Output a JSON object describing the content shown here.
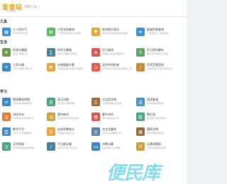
{
  "header": {
    "logo": "查查站",
    "logo_sub": "一 天天查询",
    "nav": "常用工具 ˅"
  },
  "sections": [
    {
      "title": "工具",
      "items": [
        {
          "title": "二十四节气",
          "desc": "24节气时间查询",
          "icon": "calendar-icon",
          "color": "#3a8fd6",
          "glyph": "▦"
        },
        {
          "title": "大家文创查询",
          "desc": "一键查询文创全方位查询",
          "icon": "document-icon",
          "color": "#5db865",
          "glyph": "▤"
        },
        {
          "title": "姓名缘分测试",
          "desc": "通过双方姓名测试配对指数",
          "icon": "heart-icon",
          "color": "#e8a33d",
          "glyph": "♥"
        },
        {
          "title": "星座性格查询",
          "desc": "一键查询十二星座性格",
          "icon": "star-icon",
          "color": "#3e8fd4",
          "glyph": "★"
        }
      ]
    },
    {
      "title": "生活",
      "items": [
        {
          "title": "在线计算器",
          "desc": "在线计算器工具",
          "icon": "calculator-icon",
          "color": "#6a9a4a",
          "glyph": "#"
        },
        {
          "title": "科学计算器",
          "desc": "科学计算器在线使用",
          "icon": "calculator-icon",
          "color": "#4a7f9c",
          "glyph": "∑"
        },
        {
          "title": "生日查询",
          "desc": "查询生日对应的星座日子",
          "icon": "cake-icon",
          "color": "#d9534f",
          "glyph": "✿"
        },
        {
          "title": "生日密码解析",
          "desc": "解析属于你的生日密码",
          "icon": "number-icon",
          "color": "#5aa06a",
          "glyph": "9"
        },
        {
          "title": "工资计算",
          "desc": "工资计算器个税计算",
          "icon": "money-icon",
          "color": "#3b86c7",
          "glyph": "¥"
        },
        {
          "title": "存储速度计算",
          "desc": "存储设备读写速度计算结果",
          "icon": "disk-icon",
          "color": "#e6a23c",
          "glyph": "⬒"
        },
        {
          "title": "北京时间检查",
          "desc": "北京时间北京时间标准在线工具",
          "icon": "clock-icon",
          "color": "#e05b4b",
          "glyph": "◷"
        },
        {
          "title": "声音音频音标",
          "desc": "在线查询汉字音标对照大全",
          "icon": "audio-icon",
          "color": "#c8883a",
          "glyph": "♪"
        }
      ]
    },
    {
      "title": "学习",
      "items": [
        {
          "title": "简体繁体转换",
          "desc": "在线将简体繁体转换",
          "icon": "convert-icon",
          "color": "#3b86c7",
          "glyph": "⇄"
        },
        {
          "title": "英汉词典",
          "desc": "在线英汉词典查询",
          "icon": "dictionary-icon",
          "color": "#46a27a",
          "glyph": "英"
        },
        {
          "title": "古汉语字典",
          "desc": "古汉语字典在线查询",
          "icon": "book-icon",
          "color": "#9c6b3e",
          "glyph": "古"
        },
        {
          "title": "成语查询",
          "desc": "在线成语词典查询",
          "icon": "idiom-icon",
          "color": "#4a8fc2",
          "glyph": "成"
        },
        {
          "title": "诗词名句",
          "desc": "诗词名句在线查询大全",
          "icon": "poem-icon",
          "color": "#e07b39",
          "glyph": "诗"
        },
        {
          "title": "唐诗宋词",
          "desc": "唐诗宋词名句在线查询",
          "icon": "scroll-icon",
          "color": "#c9a13e",
          "glyph": "词"
        },
        {
          "title": "春节诗词",
          "desc": "春节诗句在线大全",
          "icon": "lantern-icon",
          "color": "#d9534f",
          "glyph": "春"
        },
        {
          "title": "歇后语",
          "desc": "歇后语大全在线查询",
          "icon": "quote-icon",
          "color": "#46a27a",
          "glyph": "歇"
        },
        {
          "title": "数字大写",
          "desc": "人民币大写金额转换",
          "icon": "number-icon",
          "color": "#3b86c7",
          "glyph": "壹"
        },
        {
          "title": "在线字数统计",
          "desc": "字数统计在线工具",
          "icon": "count-icon",
          "color": "#e6a23c",
          "glyph": "字"
        },
        {
          "title": "文言文翻译",
          "desc": "文言文在线翻译工具",
          "icon": "translate-icon",
          "color": "#5b7fa6",
          "glyph": "文"
        },
        {
          "title": "康熙字典",
          "desc": "康熙字典在线查询",
          "icon": "book-icon",
          "color": "#8a6d3b",
          "glyph": "康"
        },
        {
          "title": "汉字简体",
          "desc": "汉字简体繁体在线查询",
          "icon": "character-icon",
          "color": "#46a27a",
          "glyph": "汉"
        },
        {
          "title": "平方根计算",
          "desc": "在线平方根计算工具",
          "icon": "sqrt-icon",
          "color": "#4a7f9c",
          "glyph": "√"
        },
        {
          "title": "对数计算",
          "desc": "在线对数log计算器",
          "icon": "log-icon",
          "color": "#3b86c7",
          "glyph": "log"
        },
        {
          "title": "元素周期表",
          "desc": "化学元素周期表查询",
          "icon": "element-icon",
          "color": "#c9a13e",
          "glyph": "H"
        }
      ]
    }
  ],
  "watermark": "便民库"
}
